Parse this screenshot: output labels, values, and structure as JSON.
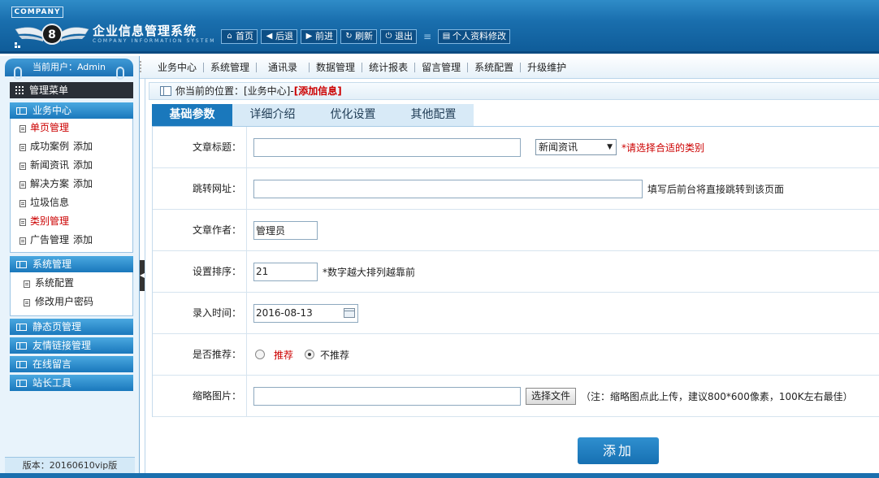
{
  "header": {
    "company_tag": "COMPANY",
    "title": "企业信息管理系统",
    "subtitle": "COMPANY INFORMATION SYSTEM",
    "nav": [
      {
        "icon": "home-icon",
        "label": "首页"
      },
      {
        "icon": "back-arrow-icon",
        "label": "后退"
      },
      {
        "icon": "forward-arrow-icon",
        "label": "前进"
      },
      {
        "icon": "refresh-icon",
        "label": "刷新"
      },
      {
        "icon": "power-icon",
        "label": "退出"
      },
      {
        "icon": "profile-icon",
        "label": "个人资料修改"
      }
    ]
  },
  "sidebar": {
    "user_label": "当前用户：Admin",
    "menu_title": "管理菜单",
    "groups": [
      {
        "title": "业务中心",
        "items": [
          {
            "label": "单页管理",
            "red": true,
            "add": ""
          },
          {
            "label": "成功案例",
            "red": false,
            "add": "添加"
          },
          {
            "label": "新闻资讯",
            "red": false,
            "add": "添加"
          },
          {
            "label": "解决方案",
            "red": false,
            "add": "添加"
          },
          {
            "label": "垃圾信息",
            "red": false,
            "add": ""
          },
          {
            "label": "类别管理",
            "red": true,
            "add": ""
          },
          {
            "label": "广告管理",
            "red": false,
            "add": "添加"
          }
        ]
      },
      {
        "title": "系统管理",
        "items": [
          {
            "label": "系统配置",
            "red": false,
            "add": ""
          },
          {
            "label": "修改用户密码",
            "red": false,
            "add": ""
          }
        ]
      },
      {
        "title": "静态页管理",
        "items": []
      },
      {
        "title": "友情链接管理",
        "items": []
      },
      {
        "title": "在线留言",
        "items": []
      },
      {
        "title": "站长工具",
        "items": []
      }
    ],
    "version": "版本：20160610vip版"
  },
  "subnav": [
    "业务中心",
    "系统管理",
    "通讯录",
    "数据管理",
    "统计报表",
    "留言管理",
    "系统配置",
    "升级维护"
  ],
  "breadcrumb": {
    "prefix": "你当前的位置：[业务中心]-",
    "current": "[添加信息]"
  },
  "tabs": [
    "基础参数",
    "详细介绍",
    "优化设置",
    "其他配置"
  ],
  "active_tab": 0,
  "form": {
    "title_label": "文章标题：",
    "title_value": "",
    "category_selected": "新闻资讯",
    "category_hint": "*请选择合适的类别",
    "redirect_label": "跳转网址：",
    "redirect_value": "",
    "redirect_hint": "填写后前台将直接跳转到该页面",
    "author_label": "文章作者：",
    "author_value": "管理员",
    "order_label": "设置排序：",
    "order_value": "21",
    "order_hint": "*数字越大排列越靠前",
    "date_label": "录入时间：",
    "date_value": "2016-08-13",
    "recommend_label": "是否推荐：",
    "recommend_yes": "推荐",
    "recommend_no": "不推荐",
    "recommend_selected": "no",
    "thumb_label": "缩略图片：",
    "thumb_value": "",
    "thumb_button": "选择文件",
    "thumb_hint": "（注：缩略图点此上传，建议800*600像素，100K左右最佳）"
  },
  "submit_label": "添加",
  "colors": {
    "header_blue": "#1a6fae",
    "accent_blue": "#1a78bc",
    "hint_red": "#cc0000"
  }
}
